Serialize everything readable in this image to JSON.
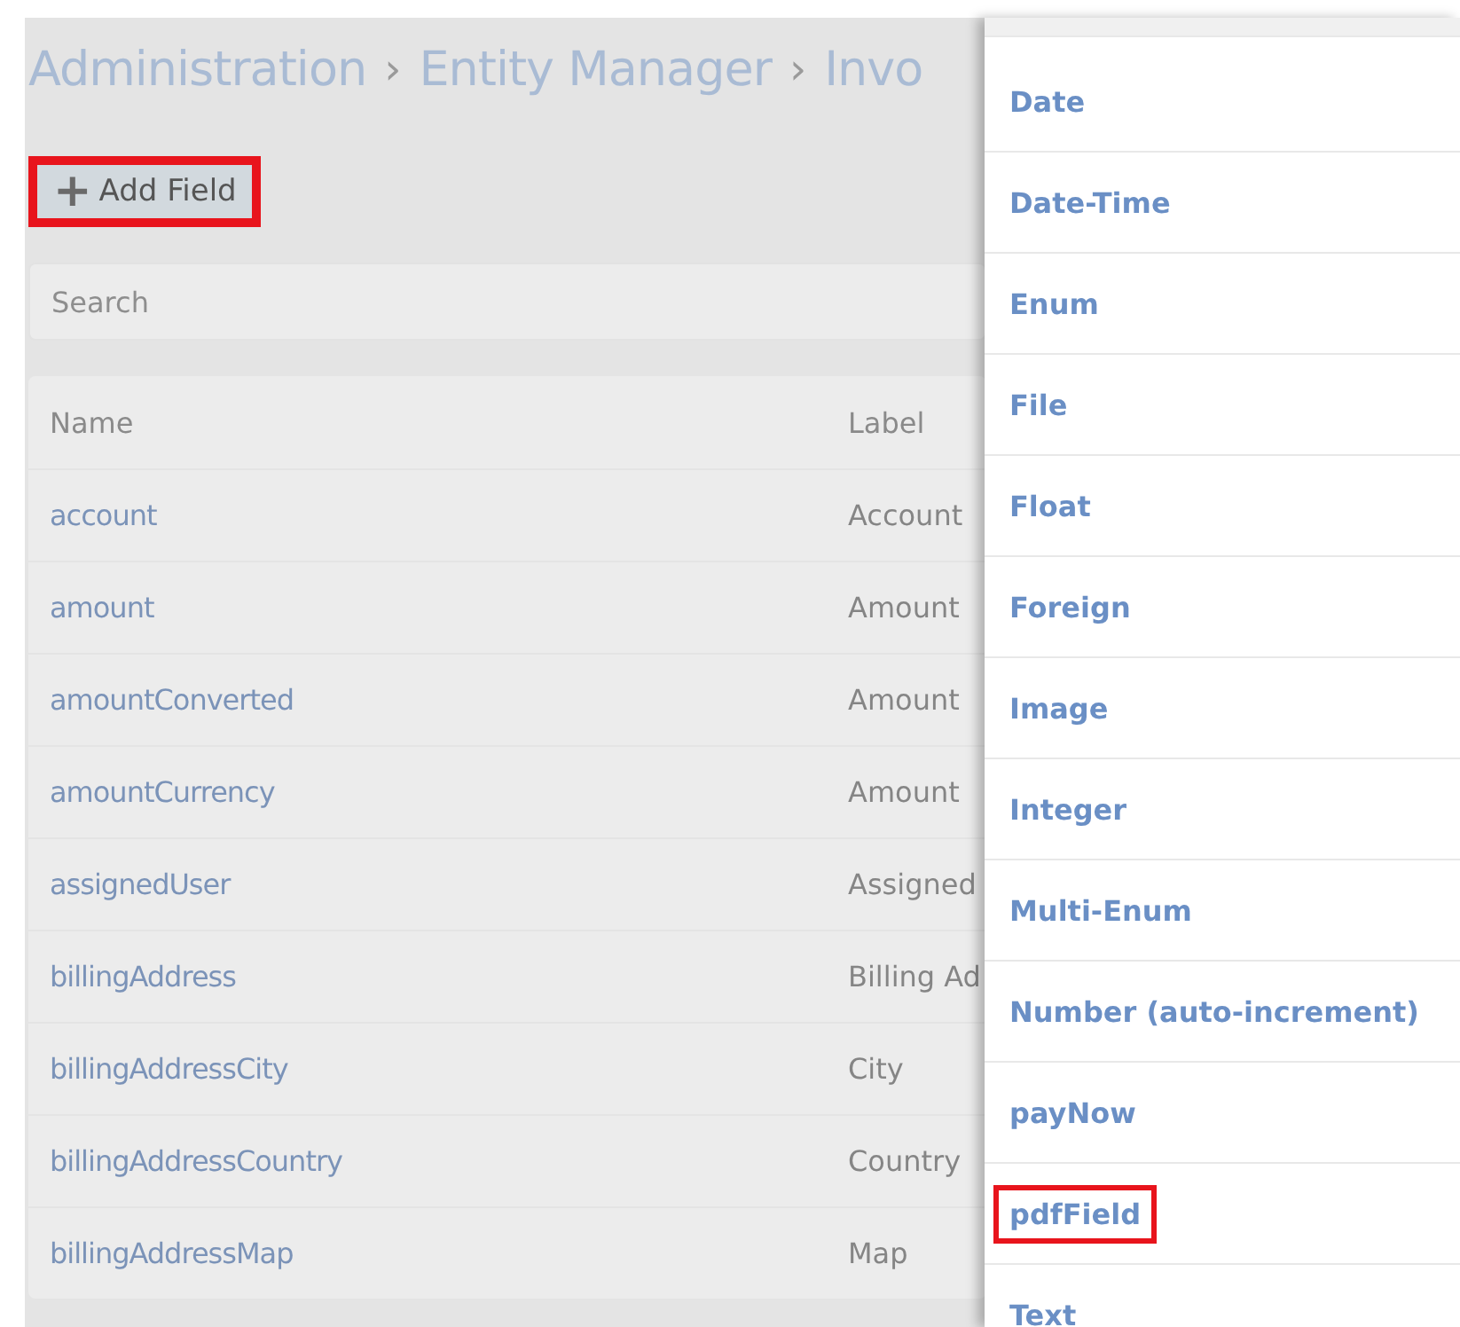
{
  "breadcrumb": [
    "Administration",
    "Entity Manager",
    "Invo"
  ],
  "separator": "›",
  "add_button": {
    "icon": "+",
    "label": "Add Field",
    "highlighted": true
  },
  "search": {
    "placeholder": "Search"
  },
  "table": {
    "columns": [
      "Name",
      "Label"
    ],
    "rows": [
      {
        "name": "account",
        "label": "Account"
      },
      {
        "name": "amount",
        "label": "Amount"
      },
      {
        "name": "amountConverted",
        "label": "Amount"
      },
      {
        "name": "amountCurrency",
        "label": "Amount"
      },
      {
        "name": "assignedUser",
        "label": "Assigned"
      },
      {
        "name": "billingAddress",
        "label": "Billing Ad"
      },
      {
        "name": "billingAddressCity",
        "label": "City"
      },
      {
        "name": "billingAddressCountry",
        "label": "Country"
      },
      {
        "name": "billingAddressMap",
        "label": "Map"
      }
    ]
  },
  "field_types": [
    {
      "label": "Date",
      "highlighted": false
    },
    {
      "label": "Date-Time",
      "highlighted": false
    },
    {
      "label": "Enum",
      "highlighted": false
    },
    {
      "label": "File",
      "highlighted": false
    },
    {
      "label": "Float",
      "highlighted": false
    },
    {
      "label": "Foreign",
      "highlighted": false
    },
    {
      "label": "Image",
      "highlighted": false
    },
    {
      "label": "Integer",
      "highlighted": false
    },
    {
      "label": "Multi-Enum",
      "highlighted": false
    },
    {
      "label": "Number (auto-increment)",
      "highlighted": false
    },
    {
      "label": "payNow",
      "highlighted": false
    },
    {
      "label": "pdfField",
      "highlighted": true
    },
    {
      "label": "Text",
      "highlighted": false
    }
  ]
}
